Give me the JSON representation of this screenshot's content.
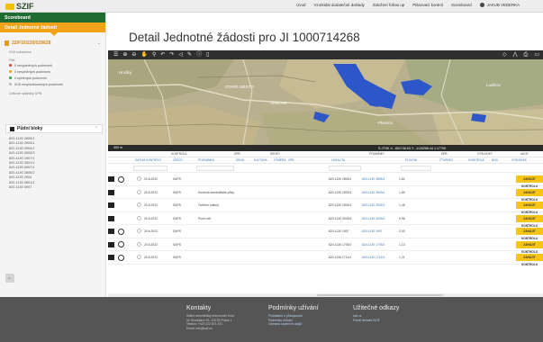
{
  "header": {
    "logo": "SZIF",
    "nav": [
      "Úvod",
      "Vzorkidat dodatečné doklady",
      "Založení follow up",
      "Plánovací kontrol",
      "Scoreboard"
    ],
    "user": "JAKUB VEDERKA"
  },
  "sidebar": {
    "scoreboard": "Scoreboard",
    "detail": "Detail Jednotné žádosti",
    "application": "22/F10/220/029628",
    "app_meta": "0/18 zobrazeno",
    "filter_label": "Filtr:",
    "legend": [
      {
        "label": "0 nevyplněných podmínek",
        "color": "#d93a2b"
      },
      {
        "label": "0 nesplněných podmínek",
        "color": "#f0a21a"
      },
      {
        "label": "0 splněných podmínek",
        "color": "#2f9e44"
      },
      {
        "label": "0/18 nevyhodnocených podmínek",
        "color": "#bbbbbb"
      }
    ],
    "extra": "Celkové výsledky DPB",
    "blocks_title": "Půdní bloky",
    "blocks": [
      "820-1130 2805/1",
      "820-1130 2903/1",
      "820-1130 2904/1",
      "820-1130 3003/3",
      "820-1130 1907/1",
      "820-1130 3001/1",
      "820-1130 0907/1",
      "820-1130 2806/2",
      "820-1130 2904",
      "820-1130 0801/1",
      "820-1130 0907"
    ]
  },
  "main": {
    "title": "Detail Jednotné žádosti pro JI 1000714268",
    "map_scale": "300 m",
    "map_coords": "S-JTSK    X: -651746.63    Y: -1126268.44    1:17796",
    "map_places": [
      "STARÉ MĚSTO",
      "VRBOVÉ",
      "Hrušky",
      "Plumlov",
      "Ludérov"
    ]
  },
  "table": {
    "groups": [
      "KONTROLA",
      "DPB",
      "KROKY",
      "PODMÍNKY",
      "DPB",
      "VÝSLEDKY",
      "AKCE"
    ],
    "columns": [
      "DATUM KONTROLY",
      "ZDROJ",
      "POZNÁMKA",
      "DRUH",
      "KULTURA",
      "VÝMĚRA",
      "VPB",
      "LOKALITA",
      "PLOCHA",
      "ČTVEREC",
      "KONTROLA",
      "BOD",
      "VÝSLEDEK"
    ],
    "rows": [
      {
        "date": "20.6.2022",
        "src": "SAPS",
        "note": "",
        "dpb": "820-1130 2805/1",
        "link": "820-1130 2805/1",
        "val": "1,62",
        "expand": true
      },
      {
        "date": "20.6.2022",
        "src": "SAPS",
        "note": "Kontrola zemědělské půdy",
        "dpb": "820-1130 2903/1",
        "link": "820-1130 2903/1",
        "val": "1,80",
        "expand": false
      },
      {
        "date": "20.6.2022",
        "src": "SAPS",
        "note": "Ověření kultury",
        "dpb": "820-1130 2904/1",
        "link": "820-1130 2904/1",
        "val": "1,45",
        "expand": false
      },
      {
        "date": "20.6.2022",
        "src": "SAPS",
        "note": "Ploch vět.",
        "dpb": "820-1130 3003/3",
        "link": "820-1130 3003/3",
        "val": "0,96",
        "expand": false
      },
      {
        "date": "20.6.2022",
        "src": "SAPS",
        "note": "",
        "dpb": "820-1130 1907",
        "link": "820-1130 1907",
        "val": "2,00",
        "expand": true
      },
      {
        "date": "20.6.2022",
        "src": "SAPS",
        "note": "",
        "dpb": "820-1130 1705/1",
        "link": "820-1130 1705/1",
        "val": "1,13",
        "expand": true
      },
      {
        "date": "20.6.2022",
        "src": "SAPS",
        "note": "",
        "dpb": "820-1130 1714/1",
        "link": "820-1130 1714/1",
        "val": "1,21",
        "expand": true
      }
    ],
    "action_label": "ZAHÁJIT KONTROLU"
  },
  "footer": {
    "contacts": {
      "title": "Kontakty",
      "lines": [
        "Státní zemědělský intervenční fond",
        "",
        "Ve Smečkách 33, 110 00 Praha 1",
        "Telefon: +420 222 871 871",
        "Email: info@szif.cz"
      ]
    },
    "terms": {
      "title": "Podmínky užívání",
      "links": [
        "Prohlášení o přístupnosti",
        "Podmínky užívání",
        "Ochrana osobních údajů"
      ]
    },
    "useful": {
      "title": "Užitečné odkazy",
      "links": [
        "szif.cz",
        "Portál farmáře SZIF"
      ]
    }
  }
}
